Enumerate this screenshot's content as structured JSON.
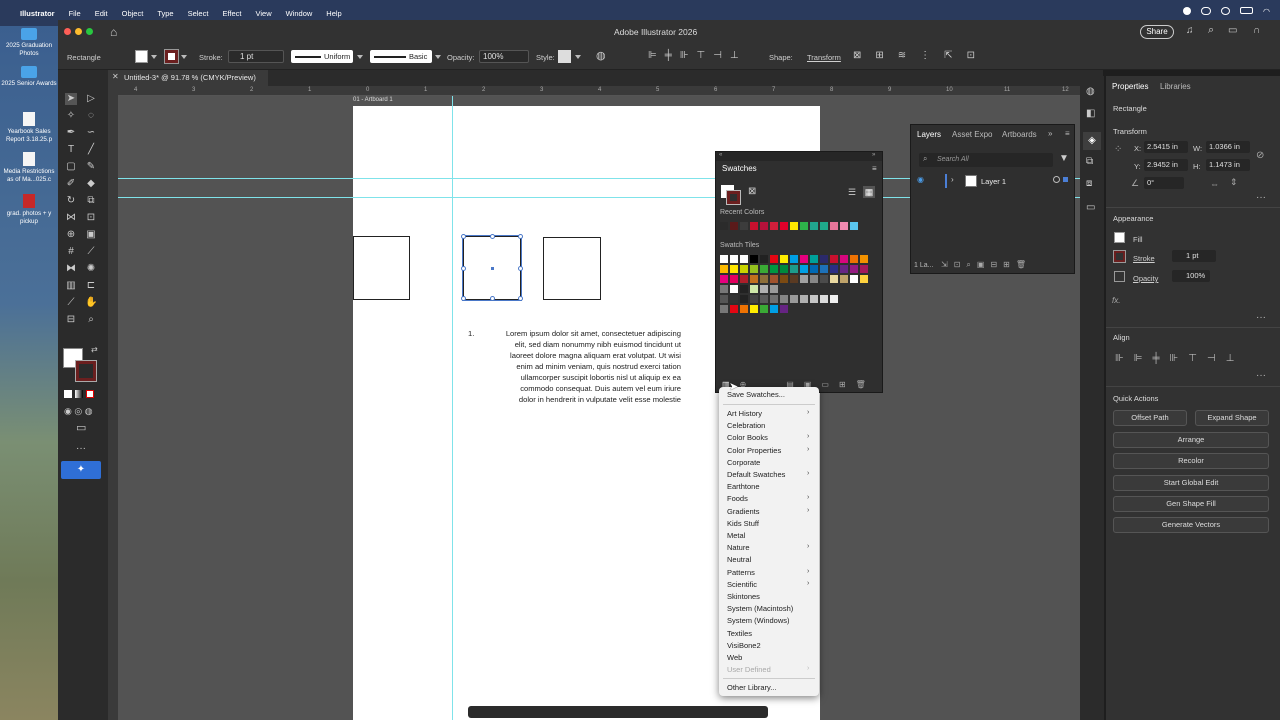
{
  "menubar": {
    "app": "Illustrator",
    "items": [
      "File",
      "Edit",
      "Object",
      "Type",
      "Select",
      "Effect",
      "View",
      "Window",
      "Help"
    ]
  },
  "desktop": {
    "icons": [
      "2025 Graduation Photos",
      "2025 Senior Awards",
      "Yearbook Sales Report 3.18.25.p",
      "Media Restrictions as of Ma...025.c",
      "grad. photos + y pickup"
    ]
  },
  "titlebar": {
    "title": "Adobe Illustrator 2026",
    "share": "Share"
  },
  "control": {
    "object_type": "Rectangle",
    "stroke_label": "Stroke:",
    "stroke_value": "1 pt",
    "profile": "Uniform",
    "brush": "Basic",
    "opacity_label": "Opacity:",
    "opacity_value": "100%",
    "style_label": "Style:",
    "shape_label": "Shape:",
    "transform_label": "Transform"
  },
  "doc_tab": "Untitled-3* @ 91.78 % (CMYK/Preview)",
  "artboard_label": "01 - Artboard 1",
  "ruler_ticks": [
    "4",
    "3",
    "2",
    "1",
    "0",
    "1",
    "2",
    "3",
    "4",
    "5",
    "6",
    "7",
    "8",
    "9",
    "10",
    "11",
    "12"
  ],
  "text_block": {
    "number": "1.",
    "lines": [
      "Lorem ipsum dolor sit amet, consectetuer adipiscing",
      "elit, sed diam nonummy nibh euismod tincidunt ut",
      "laoreet dolore magna aliquam erat volutpat. Ut wisi",
      "enim ad minim veniam, quis nostrud exerci tation",
      "ullamcorper suscipit lobortis nisl ut aliquip ex ea",
      "commodo consequat. Duis autem vel eum iriure",
      "dolor in hendrerit in vulputate velit esse molestie"
    ]
  },
  "swatches": {
    "title": "Swatches",
    "recent_colors": "Recent Colors",
    "swatch_tiles": "Swatch Tiles",
    "recent": [
      "#2b2b2b",
      "#5a1a1a",
      "#3c3c3c",
      "#c8102e",
      "#b5123a",
      "#d11f3b",
      "#e0002a",
      "#ffe600",
      "#2eb34a",
      "#21a58e",
      "#1faa8b",
      "#e7769a",
      "#f28ab0",
      "#5ac6ef"
    ]
  },
  "library_menu": {
    "save": "Save Swatches...",
    "items": [
      {
        "label": "Art History",
        "sub": true
      },
      {
        "label": "Celebration",
        "sub": false
      },
      {
        "label": "Color Books",
        "sub": true
      },
      {
        "label": "Color Properties",
        "sub": true
      },
      {
        "label": "Corporate",
        "sub": false
      },
      {
        "label": "Default Swatches",
        "sub": true
      },
      {
        "label": "Earthtone",
        "sub": false
      },
      {
        "label": "Foods",
        "sub": true
      },
      {
        "label": "Gradients",
        "sub": true
      },
      {
        "label": "Kids Stuff",
        "sub": false
      },
      {
        "label": "Metal",
        "sub": false
      },
      {
        "label": "Nature",
        "sub": true
      },
      {
        "label": "Neutral",
        "sub": false
      },
      {
        "label": "Patterns",
        "sub": true
      },
      {
        "label": "Scientific",
        "sub": true
      },
      {
        "label": "Skintones",
        "sub": false
      },
      {
        "label": "System (Macintosh)",
        "sub": false
      },
      {
        "label": "System (Windows)",
        "sub": false
      },
      {
        "label": "Textiles",
        "sub": false
      },
      {
        "label": "VisiBone2",
        "sub": false
      },
      {
        "label": "Web",
        "sub": false
      },
      {
        "label": "User Defined",
        "sub": true,
        "disabled": true
      }
    ],
    "other": "Other Library..."
  },
  "layers": {
    "tab_layers": "Layers",
    "tab_asset": "Asset Expo",
    "tab_artboards": "Artboards",
    "search_placeholder": "Search All",
    "layer_name": "Layer 1",
    "footer": "1 La..."
  },
  "properties": {
    "tab_properties": "Properties",
    "tab_libraries": "Libraries",
    "object_type": "Rectangle",
    "transform": "Transform",
    "x_label": "X:",
    "x_value": "2.5415 in",
    "w_label": "W:",
    "w_value": "1.0366 in",
    "y_label": "Y:",
    "y_value": "2.9452 in",
    "h_label": "H:",
    "h_value": "1.1473 in",
    "angle": "0°",
    "appearance": "Appearance",
    "fill": "Fill",
    "stroke": "Stroke",
    "stroke_value": "1 pt",
    "opacity": "Opacity",
    "opacity_value": "100%",
    "fx": "fx.",
    "align": "Align",
    "quick_actions": "Quick Actions",
    "offset_path": "Offset Path",
    "expand_shape": "Expand Shape",
    "arrange": "Arrange",
    "recolor": "Recolor",
    "global_edit": "Start Global Edit",
    "gen_shape_fill": "Gen Shape Fill",
    "generate_vectors": "Generate Vectors"
  },
  "colors": {
    "accent": "#4b7fd6",
    "selection": "#4a78c8",
    "guide": "#3fd6e0",
    "stroke_swatch": "#6b1f1f"
  }
}
